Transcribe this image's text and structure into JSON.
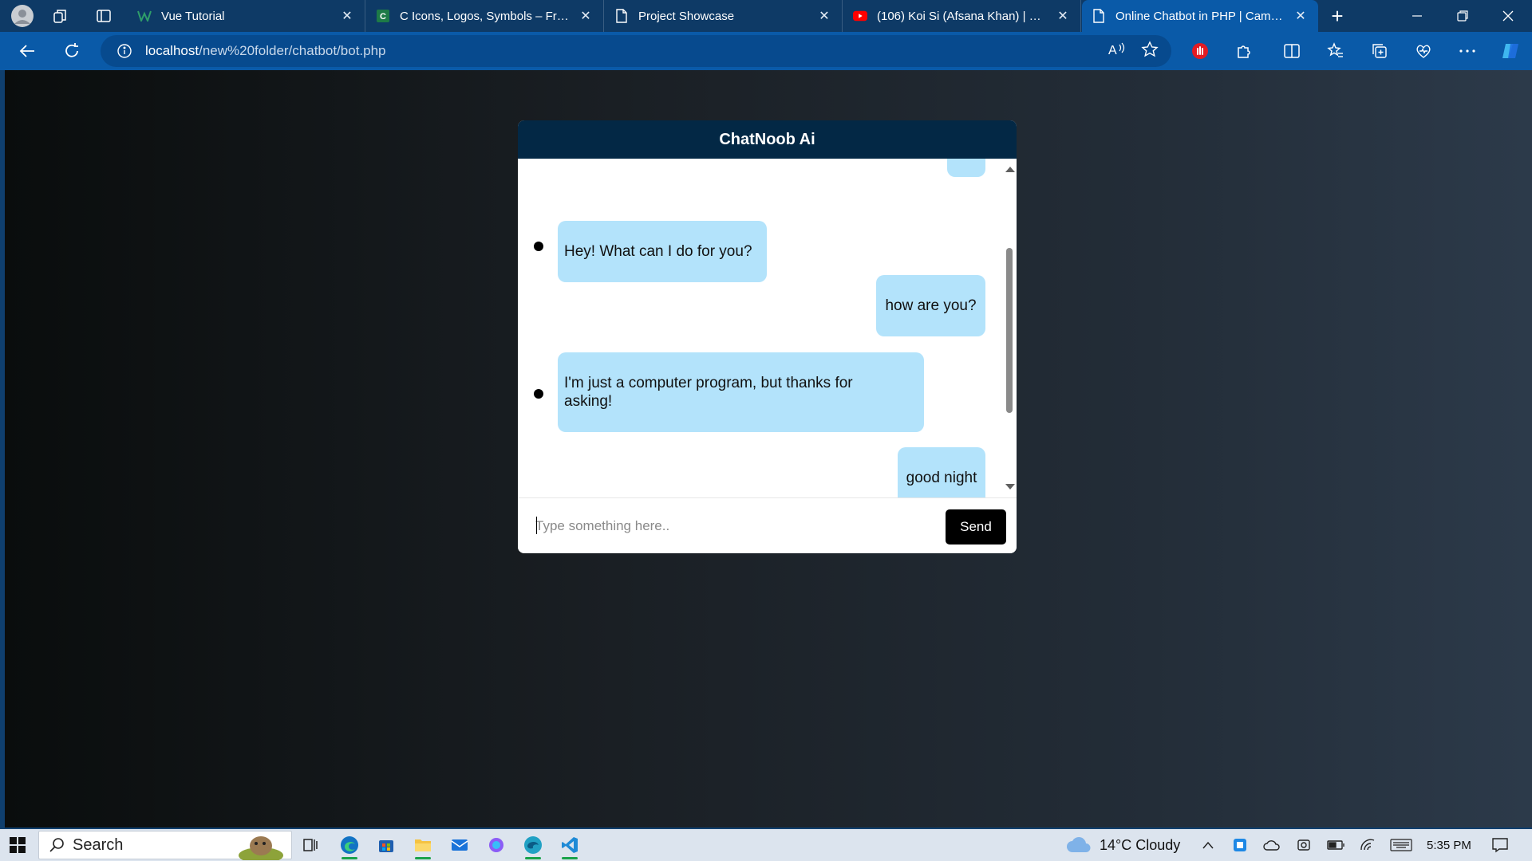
{
  "browser": {
    "tabs": [
      {
        "title": "Vue Tutorial",
        "favicon": "vue-w-icon",
        "active": false
      },
      {
        "title": "C Icons, Logos, Symbols – Free D",
        "favicon": "green-c-icon",
        "active": false
      },
      {
        "title": "Project Showcase",
        "favicon": "page-icon",
        "active": false
      },
      {
        "title": "(106) Koi Si (Afsana Khan) | Slowe",
        "favicon": "youtube-icon",
        "active": false
      },
      {
        "title": "Online Chatbot in PHP | CampCo",
        "favicon": "page-icon",
        "active": true
      }
    ],
    "new_tab": "+",
    "url_host": "localhost",
    "url_path": "/new%20folder/chatbot/bot.php",
    "accent": "#0a5aa8"
  },
  "chat": {
    "title": "ChatNoob Ai",
    "messages": [
      {
        "from": "bot",
        "text": "Hey! What can I do for you?"
      },
      {
        "from": "user",
        "text": "how are you?"
      },
      {
        "from": "bot",
        "text": "I'm just a computer program, but thanks for asking!"
      },
      {
        "from": "user",
        "text": "good night"
      }
    ],
    "input_placeholder": "Type something here..",
    "input_value": "",
    "send_label": "Send",
    "header_color": "#032845",
    "bubble_color": "#b3e3fb"
  },
  "taskbar": {
    "search_label": "Search",
    "weather": "14°C  Cloudy",
    "time": "5:35 PM"
  }
}
